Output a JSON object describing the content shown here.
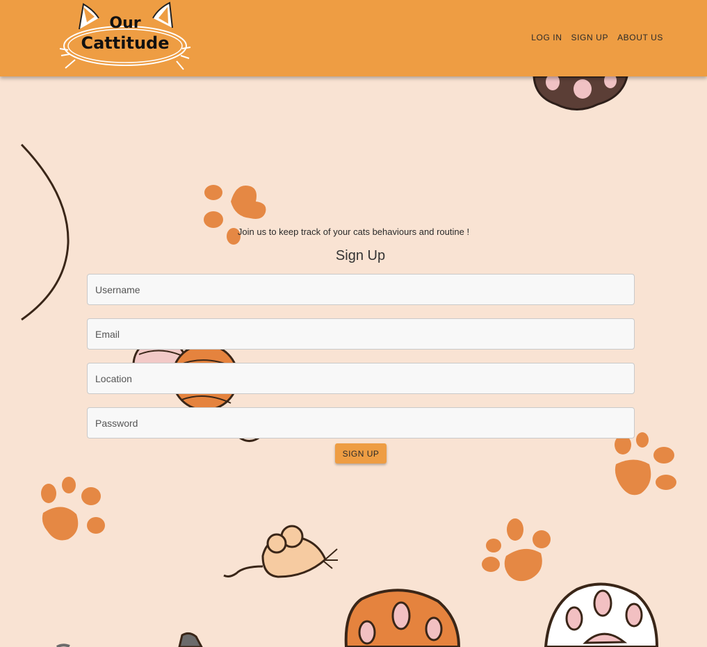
{
  "brand": {
    "logo_line1": "Our",
    "logo_line2": "Cattitude"
  },
  "nav": {
    "login": "LOG IN",
    "signup": "SIGN UP",
    "about": "ABOUT US"
  },
  "form": {
    "tagline": "Join us to keep track of your cats behaviours and routine !",
    "title": "Sign Up",
    "username_placeholder": "Username",
    "email_placeholder": "Email",
    "location_placeholder": "Location",
    "password_placeholder": "Password",
    "submit_label": "SIGN UP"
  },
  "colors": {
    "header": "#ee9d43",
    "background": "#f9e3d3",
    "paw": "#e58844"
  },
  "icons": [
    "cat-ears-icon",
    "paw-print-icon",
    "yarn-ball-icon",
    "toy-mouse-icon",
    "cat-paw-icon",
    "cat-tail-icon"
  ]
}
